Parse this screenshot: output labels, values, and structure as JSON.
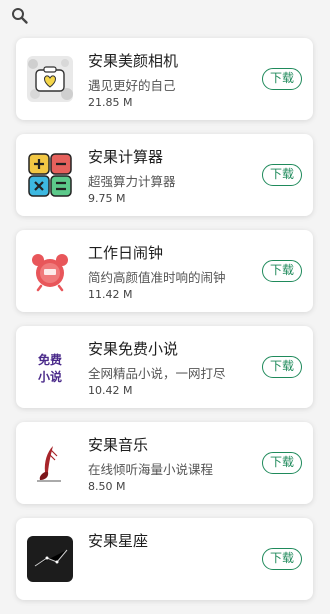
{
  "header": {
    "search_icon": "search-icon"
  },
  "colors": {
    "accent": "#1f8a5b",
    "background": "#f4f4f4"
  },
  "apps": [
    {
      "title": "安果美颜相机",
      "desc": "遇见更好的自己",
      "size": "21.85 M",
      "button": "下载",
      "icon": "camera-icon"
    },
    {
      "title": "安果计算器",
      "desc": "超强算力计算器",
      "size": "9.75 M",
      "button": "下载",
      "icon": "calculator-icon"
    },
    {
      "title": "工作日闹钟",
      "desc": "简约高颜值准时响的闹钟",
      "size": "11.42 M",
      "button": "下载",
      "icon": "alarm-clock-icon"
    },
    {
      "title": "安果免费小说",
      "desc": "全网精品小说，一网打尽",
      "size": "10.42 M",
      "button": "下载",
      "icon": "novel-book-icon",
      "icon_text": [
        "免费",
        "小说"
      ]
    },
    {
      "title": "安果音乐",
      "desc": "在线倾听海量小说课程",
      "size": "8.50 M",
      "button": "下载",
      "icon": "music-quill-icon"
    },
    {
      "title": "安果星座",
      "desc": "",
      "size": "",
      "button": "下载",
      "icon": "constellation-icon"
    }
  ]
}
